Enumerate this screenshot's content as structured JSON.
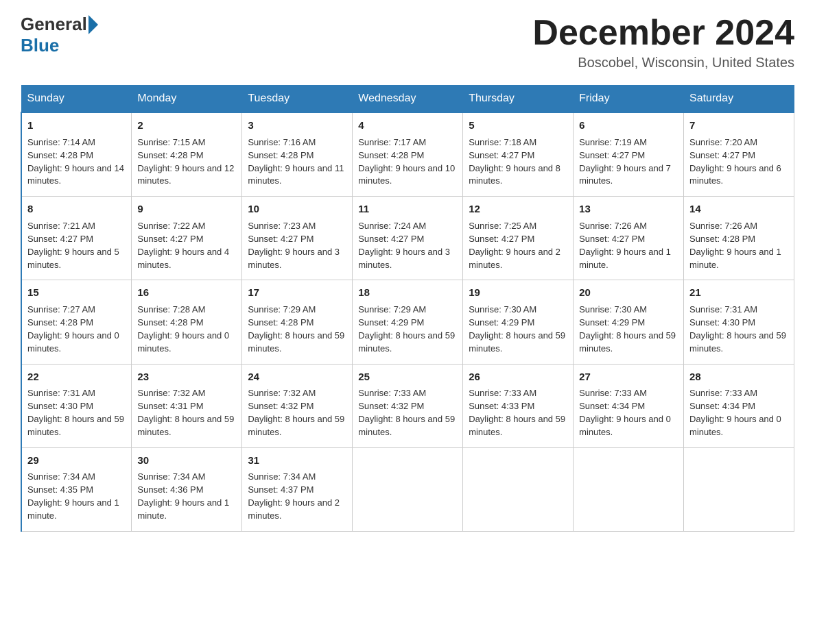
{
  "header": {
    "logo_general": "General",
    "logo_blue": "Blue",
    "month_title": "December 2024",
    "location": "Boscobel, Wisconsin, United States"
  },
  "days_of_week": [
    "Sunday",
    "Monday",
    "Tuesday",
    "Wednesday",
    "Thursday",
    "Friday",
    "Saturday"
  ],
  "weeks": [
    [
      {
        "day": "1",
        "sunrise": "7:14 AM",
        "sunset": "4:28 PM",
        "daylight": "9 hours and 14 minutes."
      },
      {
        "day": "2",
        "sunrise": "7:15 AM",
        "sunset": "4:28 PM",
        "daylight": "9 hours and 12 minutes."
      },
      {
        "day": "3",
        "sunrise": "7:16 AM",
        "sunset": "4:28 PM",
        "daylight": "9 hours and 11 minutes."
      },
      {
        "day": "4",
        "sunrise": "7:17 AM",
        "sunset": "4:28 PM",
        "daylight": "9 hours and 10 minutes."
      },
      {
        "day": "5",
        "sunrise": "7:18 AM",
        "sunset": "4:27 PM",
        "daylight": "9 hours and 8 minutes."
      },
      {
        "day": "6",
        "sunrise": "7:19 AM",
        "sunset": "4:27 PM",
        "daylight": "9 hours and 7 minutes."
      },
      {
        "day": "7",
        "sunrise": "7:20 AM",
        "sunset": "4:27 PM",
        "daylight": "9 hours and 6 minutes."
      }
    ],
    [
      {
        "day": "8",
        "sunrise": "7:21 AM",
        "sunset": "4:27 PM",
        "daylight": "9 hours and 5 minutes."
      },
      {
        "day": "9",
        "sunrise": "7:22 AM",
        "sunset": "4:27 PM",
        "daylight": "9 hours and 4 minutes."
      },
      {
        "day": "10",
        "sunrise": "7:23 AM",
        "sunset": "4:27 PM",
        "daylight": "9 hours and 3 minutes."
      },
      {
        "day": "11",
        "sunrise": "7:24 AM",
        "sunset": "4:27 PM",
        "daylight": "9 hours and 3 minutes."
      },
      {
        "day": "12",
        "sunrise": "7:25 AM",
        "sunset": "4:27 PM",
        "daylight": "9 hours and 2 minutes."
      },
      {
        "day": "13",
        "sunrise": "7:26 AM",
        "sunset": "4:27 PM",
        "daylight": "9 hours and 1 minute."
      },
      {
        "day": "14",
        "sunrise": "7:26 AM",
        "sunset": "4:28 PM",
        "daylight": "9 hours and 1 minute."
      }
    ],
    [
      {
        "day": "15",
        "sunrise": "7:27 AM",
        "sunset": "4:28 PM",
        "daylight": "9 hours and 0 minutes."
      },
      {
        "day": "16",
        "sunrise": "7:28 AM",
        "sunset": "4:28 PM",
        "daylight": "9 hours and 0 minutes."
      },
      {
        "day": "17",
        "sunrise": "7:29 AM",
        "sunset": "4:28 PM",
        "daylight": "8 hours and 59 minutes."
      },
      {
        "day": "18",
        "sunrise": "7:29 AM",
        "sunset": "4:29 PM",
        "daylight": "8 hours and 59 minutes."
      },
      {
        "day": "19",
        "sunrise": "7:30 AM",
        "sunset": "4:29 PM",
        "daylight": "8 hours and 59 minutes."
      },
      {
        "day": "20",
        "sunrise": "7:30 AM",
        "sunset": "4:29 PM",
        "daylight": "8 hours and 59 minutes."
      },
      {
        "day": "21",
        "sunrise": "7:31 AM",
        "sunset": "4:30 PM",
        "daylight": "8 hours and 59 minutes."
      }
    ],
    [
      {
        "day": "22",
        "sunrise": "7:31 AM",
        "sunset": "4:30 PM",
        "daylight": "8 hours and 59 minutes."
      },
      {
        "day": "23",
        "sunrise": "7:32 AM",
        "sunset": "4:31 PM",
        "daylight": "8 hours and 59 minutes."
      },
      {
        "day": "24",
        "sunrise": "7:32 AM",
        "sunset": "4:32 PM",
        "daylight": "8 hours and 59 minutes."
      },
      {
        "day": "25",
        "sunrise": "7:33 AM",
        "sunset": "4:32 PM",
        "daylight": "8 hours and 59 minutes."
      },
      {
        "day": "26",
        "sunrise": "7:33 AM",
        "sunset": "4:33 PM",
        "daylight": "8 hours and 59 minutes."
      },
      {
        "day": "27",
        "sunrise": "7:33 AM",
        "sunset": "4:34 PM",
        "daylight": "9 hours and 0 minutes."
      },
      {
        "day": "28",
        "sunrise": "7:33 AM",
        "sunset": "4:34 PM",
        "daylight": "9 hours and 0 minutes."
      }
    ],
    [
      {
        "day": "29",
        "sunrise": "7:34 AM",
        "sunset": "4:35 PM",
        "daylight": "9 hours and 1 minute."
      },
      {
        "day": "30",
        "sunrise": "7:34 AM",
        "sunset": "4:36 PM",
        "daylight": "9 hours and 1 minute."
      },
      {
        "day": "31",
        "sunrise": "7:34 AM",
        "sunset": "4:37 PM",
        "daylight": "9 hours and 2 minutes."
      },
      null,
      null,
      null,
      null
    ]
  ],
  "labels": {
    "sunrise": "Sunrise:",
    "sunset": "Sunset:",
    "daylight": "Daylight:"
  }
}
